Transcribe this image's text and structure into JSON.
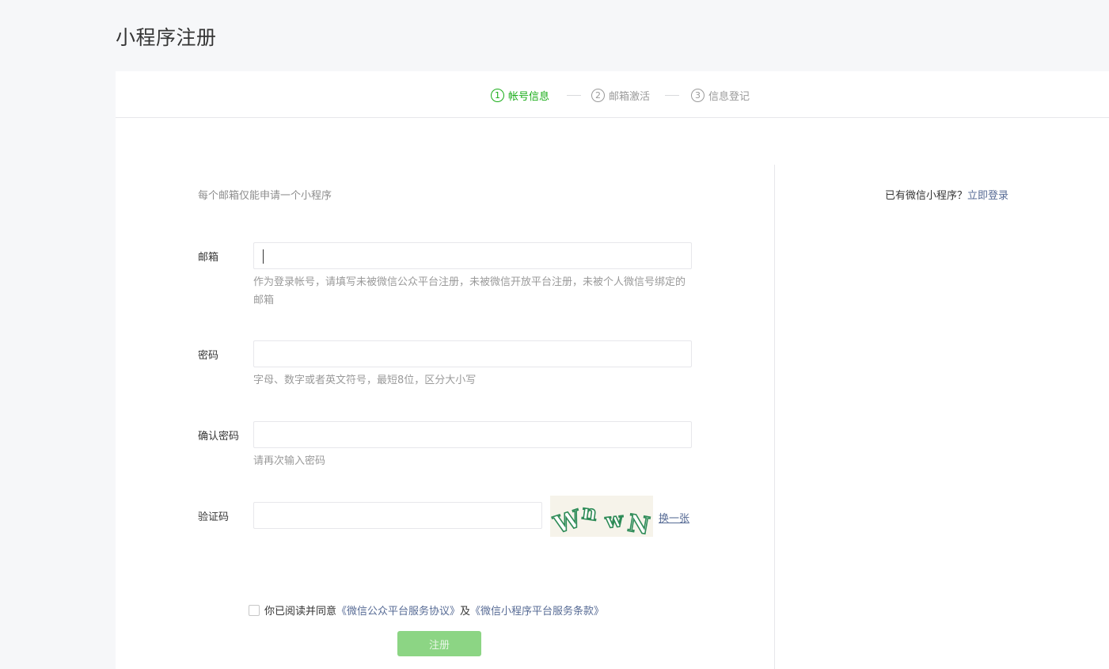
{
  "page": {
    "title": "小程序注册"
  },
  "steps": [
    {
      "num": "1",
      "label": "帐号信息",
      "active": true
    },
    {
      "num": "2",
      "label": "邮箱激活",
      "active": false
    },
    {
      "num": "3",
      "label": "信息登记",
      "active": false
    }
  ],
  "form": {
    "tip": "每个邮箱仅能申请一个小程序",
    "email": {
      "label": "邮箱",
      "value": "",
      "hint": "作为登录帐号，请填写未被微信公众平台注册，未被微信开放平台注册，未被个人微信号绑定的邮箱"
    },
    "password": {
      "label": "密码",
      "value": "",
      "hint": "字母、数字或者英文符号，最短8位，区分大小写"
    },
    "confirm": {
      "label": "确认密码",
      "value": "",
      "hint": "请再次输入密码"
    },
    "captcha": {
      "label": "验证码",
      "value": "",
      "image_text": "wnwN",
      "refresh": "换一张"
    },
    "agreement": {
      "prefix": "你已阅读并同意",
      "link1": "《微信公众平台服务协议》",
      "middle": "及",
      "link2": "《微信小程序平台服务条款》",
      "checked": false
    },
    "submit": "注册"
  },
  "sidebar": {
    "question": "已有微信小程序？",
    "login_link": "立即登录"
  },
  "colors": {
    "accent": "#1aad19",
    "link": "#576b95",
    "submit_disabled": "#8cd584"
  }
}
